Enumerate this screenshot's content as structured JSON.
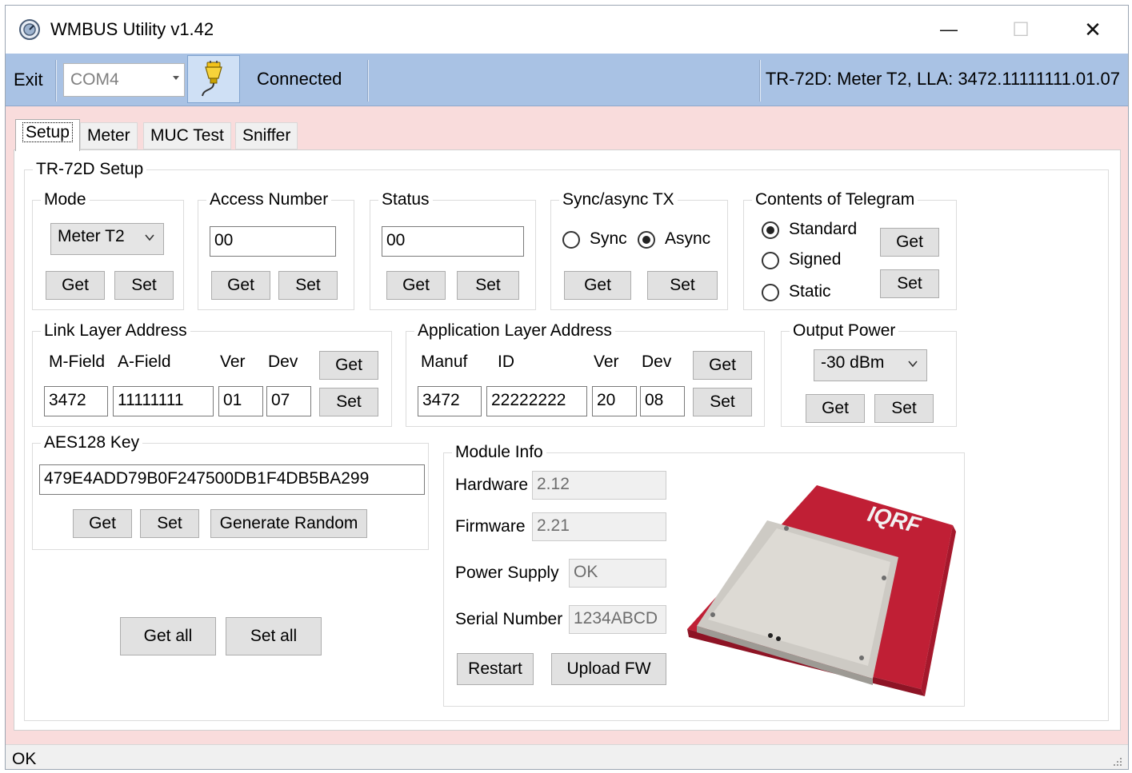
{
  "window": {
    "title": "WMBUS Utility v1.42",
    "minimize_glyph": "—",
    "maximize_glyph": "☐",
    "close_glyph": "✕"
  },
  "toolbar": {
    "exit_label": "Exit",
    "com_port": "COM4",
    "connection_status": "Connected",
    "device_info": "TR-72D: Meter T2, LLA: 3472.11111111.01.07",
    "connect_icon": "plug-icon"
  },
  "tabs": [
    {
      "label": "Setup",
      "active": true
    },
    {
      "label": "Meter"
    },
    {
      "label": "MUC Test"
    },
    {
      "label": "Sniffer"
    }
  ],
  "setup": {
    "title": "TR-72D Setup",
    "mode": {
      "title": "Mode",
      "value": "Meter T2",
      "get": "Get",
      "set": "Set"
    },
    "access_number": {
      "title": "Access Number",
      "value": "00",
      "get": "Get",
      "set": "Set"
    },
    "status": {
      "title": "Status",
      "value": "00",
      "get": "Get",
      "set": "Set"
    },
    "sync_tx": {
      "title": "Sync/async TX",
      "sync_label": "Sync",
      "async_label": "Async",
      "selected": "Async",
      "get": "Get",
      "set": "Set"
    },
    "telegram": {
      "title": "Contents of Telegram",
      "options": [
        "Standard",
        "Signed",
        "Static"
      ],
      "selected": "Standard",
      "get": "Get",
      "set": "Set"
    },
    "lla": {
      "title": "Link Layer Address",
      "headers": [
        "M-Field",
        "A-Field",
        "Ver",
        "Dev"
      ],
      "values": [
        "3472",
        "11111111",
        "01",
        "07"
      ],
      "get": "Get",
      "set": "Set"
    },
    "ala": {
      "title": "Application Layer Address",
      "headers": [
        "Manuf",
        "ID",
        "Ver",
        "Dev"
      ],
      "values": [
        "3472",
        "22222222",
        "20",
        "08"
      ],
      "get": "Get",
      "set": "Set"
    },
    "output_power": {
      "title": "Output Power",
      "value": "-30 dBm",
      "get": "Get",
      "set": "Set"
    },
    "aes": {
      "title": "AES128 Key",
      "value": "479E4ADD79B0F247500DB1F4DB5BA299",
      "get": "Get",
      "set": "Set",
      "generate": "Generate Random"
    },
    "get_all": "Get all",
    "set_all": "Set all",
    "module_info": {
      "title": "Module Info",
      "hardware_label": "Hardware",
      "hardware": "2.12",
      "firmware_label": "Firmware",
      "firmware": "2.21",
      "power_label": "Power Supply",
      "power": "OK",
      "serial_label": "Serial Number",
      "serial": "1234ABCD",
      "restart": "Restart",
      "upload": "Upload FW",
      "image_logo": "IQRF"
    }
  },
  "statusbar": {
    "text": "OK"
  }
}
